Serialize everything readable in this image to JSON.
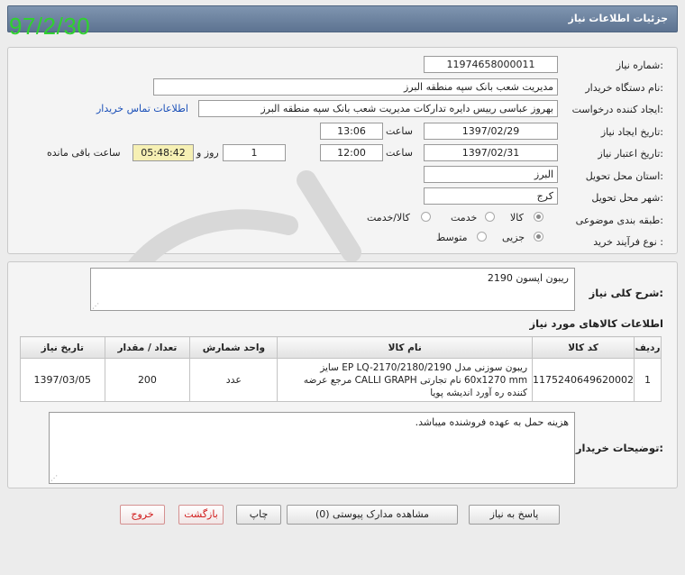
{
  "header": {
    "title": "جزئیات اطلاعات نیاز"
  },
  "stamp": {
    "date": "97/2/30"
  },
  "form": {
    "need_number_label": "شماره نیاز:",
    "need_number": "11974658000011",
    "buyer_org_label": "نام دستگاه خریدار:",
    "buyer_org": "مدیریت شعب بانک سپه منطقه البرز",
    "creator_label": "ایجاد کننده درخواست:",
    "creator": "بهروز عباسی رییس دایره تدارکات مدیریت شعب بانک سپه منطقه البرز",
    "contact_link": "اطلاعات تماس خریدار",
    "created_label": "تاریخ ایجاد نیاز:",
    "created_date": "1397/02/29",
    "time_label": "ساعت",
    "created_time": "13:06",
    "valid_label": "تاریخ اعتبار نیاز:",
    "valid_date": "1397/02/31",
    "valid_time": "12:00",
    "days_value": "1",
    "days_label": "روز و",
    "remaining_time": "05:48:42",
    "remaining_label": "ساعت باقی مانده",
    "province_label": "استان محل تحویل:",
    "province": "البرز",
    "city_label": "شهر محل تحویل:",
    "city": "کرج",
    "category_label": "طبقه بندی موضوعی:",
    "category_options": [
      "کالا",
      "خدمت",
      "کالا/خدمت"
    ],
    "process_label": "نوع فرآیند خرید :",
    "process_options": [
      "جزیی",
      "متوسط"
    ]
  },
  "description": {
    "label": "شرح کلی نیاز:",
    "text": "ریبون اپسون 2190"
  },
  "items_section": {
    "title": "اطلاعات کالاهای مورد نیاز",
    "headers": [
      "ردیف",
      "کد کالا",
      "نام کالا",
      "واحد شمارش",
      "تعداد / مقدار",
      "تاریخ نیاز"
    ],
    "rows": [
      {
        "index": "1",
        "code": "1175240649620002",
        "name": "ریبون سوزنی مدل EP LQ-2170/2180/2190 سایز 60x1270 mm نام تجارتی CALLI GRAPH مرجع عرضه کننده ره آورد اندیشه پویا",
        "unit": "عدد",
        "qty": "200",
        "date": "1397/03/05"
      }
    ]
  },
  "buyer_notes": {
    "label": "توضیحات خریدار:",
    "text": "هزینه حمل به عهده فروشنده میباشد."
  },
  "buttons": {
    "reply": "پاسخ به نیاز",
    "attachments": "مشاهده مدارک پیوستی (0)",
    "print": "چاپ",
    "back": "بازگشت",
    "exit": "خروج"
  }
}
